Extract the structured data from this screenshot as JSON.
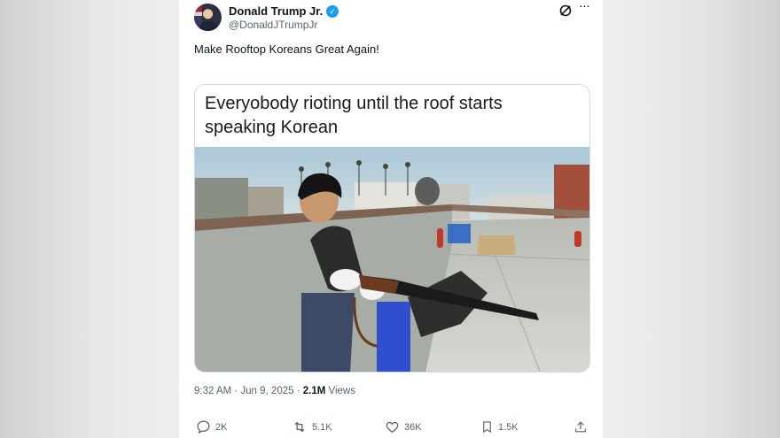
{
  "tweet": {
    "display_name": "Donald Trump Jr.",
    "handle": "@DonaldJTrumpJr",
    "verified_icon": "verified-badge-icon",
    "text": "Make Rooftop Koreans Great Again!",
    "media_caption": "Everyobody rioting until the roof starts speaking Korean",
    "timestamp": "9:32 AM · Jun 9, 2025 · ",
    "views_count": "2.1M",
    "views_label": " Views"
  },
  "actions": {
    "replies": "2K",
    "reposts": "5.1K",
    "likes": "36K",
    "bookmarks": "1.5K"
  },
  "icons": {
    "grok": "grok-icon",
    "more": "more-options-icon",
    "reply": "reply-icon",
    "repost": "repost-icon",
    "like": "heart-icon",
    "bookmark": "bookmark-icon",
    "share": "share-icon"
  },
  "colors": {
    "verified_blue": "#1d9bf0",
    "text_primary": "#0f1419",
    "text_secondary": "#536471"
  }
}
